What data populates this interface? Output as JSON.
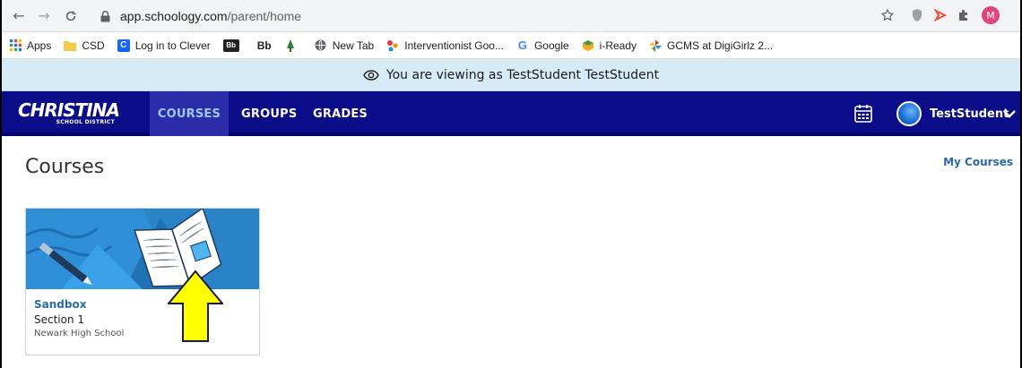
{
  "browser": {
    "url_host": "app.schoology.com",
    "url_path": "/parent/home",
    "profile_initial": "M",
    "bookmarks": [
      {
        "label": "Apps",
        "icon": "apps-grid-icon"
      },
      {
        "label": "CSD",
        "icon": "folder-icon"
      },
      {
        "label": "Log in to Clever",
        "icon": "clever-icon"
      },
      {
        "label": "",
        "icon": "blackboard-icon"
      },
      {
        "label": "Bb",
        "icon": "bb-icon"
      },
      {
        "label": "",
        "icon": "tree-icon"
      },
      {
        "label": "New Tab",
        "icon": "globe-icon"
      },
      {
        "label": "Interventionist Goo...",
        "icon": "abc-icon"
      },
      {
        "label": "Google",
        "icon": "google-icon"
      },
      {
        "label": "i-Ready",
        "icon": "iready-icon"
      },
      {
        "label": "GCMS at DigiGirlz 2...",
        "icon": "pinwheel-icon"
      }
    ]
  },
  "banner": {
    "text": "You are viewing as TestStudent TestStudent"
  },
  "header": {
    "logo_main": "CHRISTINA",
    "logo_sub": "SCHOOL DISTRICT",
    "tabs": [
      "COURSES",
      "GROUPS",
      "GRADES"
    ],
    "user_name": "TestStudent"
  },
  "main": {
    "title": "Courses",
    "my_courses_link": "My Courses",
    "course_card": {
      "course": "Sandbox",
      "section": "Section 1",
      "school": "Newark High School"
    }
  },
  "colors": {
    "header_bg": "#0a0c88",
    "banner_bg": "#d7ebf7",
    "link": "#2a6aa8",
    "arrow_fill": "#ffff00"
  }
}
